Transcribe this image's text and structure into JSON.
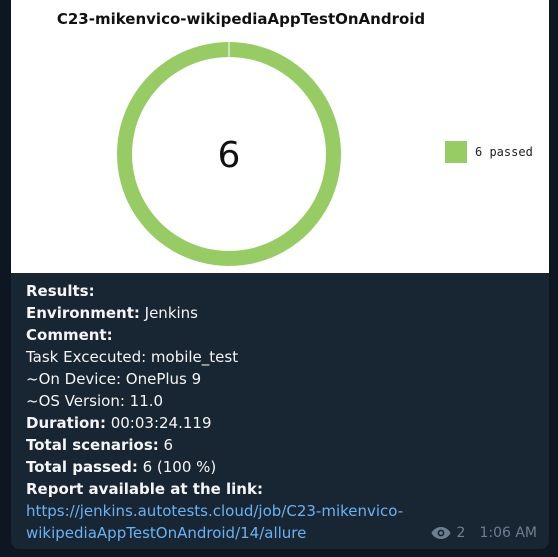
{
  "chart_data": {
    "type": "pie",
    "title": "C23-mikenvico-wikipediaAppTestOnAndroid",
    "center_label": "6",
    "slices": [
      {
        "label": "6 passed",
        "value": 6,
        "color": "#97cc64"
      }
    ]
  },
  "message": {
    "results_label": "Results:",
    "environment_label": "Environment:",
    "environment_value": " Jenkins",
    "comment_label": "Comment:",
    "task_line": "Task Excecuted: mobile_test",
    "device_line": "~On Device: OnePlus 9",
    "os_line": "~OS Version: 11.0",
    "duration_label": "Duration:",
    "duration_value": " 00:03:24.119",
    "total_scenarios_label": "Total scenarios:",
    "total_scenarios_value": " 6",
    "total_passed_label": "Total passed:",
    "total_passed_value": " 6 (100 %)",
    "report_label": "Report available at the link:",
    "link_line1": "https://jenkins.autotests.cloud/job/C23-mikenvico-",
    "link_line2": "wikipediaAppTestOnAndroid/14/allure"
  },
  "meta": {
    "views": "2",
    "time": "1:06 AM",
    "icon": "eye-icon"
  },
  "colors": {
    "background": "#0e1621",
    "bubble": "#182533",
    "link": "#6ab2f2",
    "passed": "#97cc64"
  }
}
